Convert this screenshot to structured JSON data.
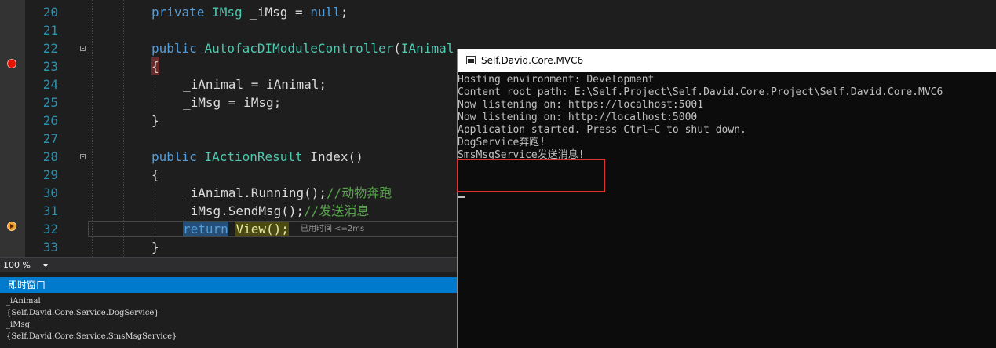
{
  "editor": {
    "zoom": "100 %",
    "lines": [
      {
        "num": "20",
        "code": "private IMsg _iMsg = null;"
      },
      {
        "num": "21",
        "code": ""
      },
      {
        "num": "22",
        "code": "public AutofacDIModuleController(IAnimal iAnimal, IMsg iMsg)"
      },
      {
        "num": "23",
        "code": "{"
      },
      {
        "num": "24",
        "code": "_iAnimal = iAnimal;"
      },
      {
        "num": "25",
        "code": "_iMsg = iMsg;"
      },
      {
        "num": "26",
        "code": "}"
      },
      {
        "num": "27",
        "code": ""
      },
      {
        "num": "28",
        "code": "public IActionResult Index()"
      },
      {
        "num": "29",
        "code": "{"
      },
      {
        "num": "30",
        "code": "_iAnimal.Running();//动物奔跑"
      },
      {
        "num": "31",
        "code": "_iMsg.SendMsg();//发送消息"
      },
      {
        "num": "32",
        "code": "return View();"
      },
      {
        "num": "33",
        "code": "}"
      }
    ],
    "perf_tip": "已用时间 <=2ms"
  },
  "immediate": {
    "title": "即时窗口",
    "lines": [
      "_iAnimal",
      "{Self.David.Core.Service.DogService}",
      "_iMsg",
      "{Self.David.Core.Service.SmsMsgService}"
    ]
  },
  "console": {
    "title": "Self.David.Core.MVC6",
    "lines": [
      "Hosting environment: Development",
      "Content root path: E:\\Self.Project\\Self.David.Core.Project\\Self.David.Core.MVC6",
      "Now listening on: https://localhost:5001",
      "Now listening on: http://localhost:5000",
      "Application started. Press Ctrl+C to shut down.",
      "DogService奔跑!",
      "SmsMsgService发送消息!"
    ]
  },
  "colors": {
    "keyword": "#569cd6",
    "type": "#4ec9b0",
    "comment": "#57a64a",
    "line_number": "#2b91af",
    "highlight_box": "#e03131",
    "immediate_title": "#007acc"
  }
}
